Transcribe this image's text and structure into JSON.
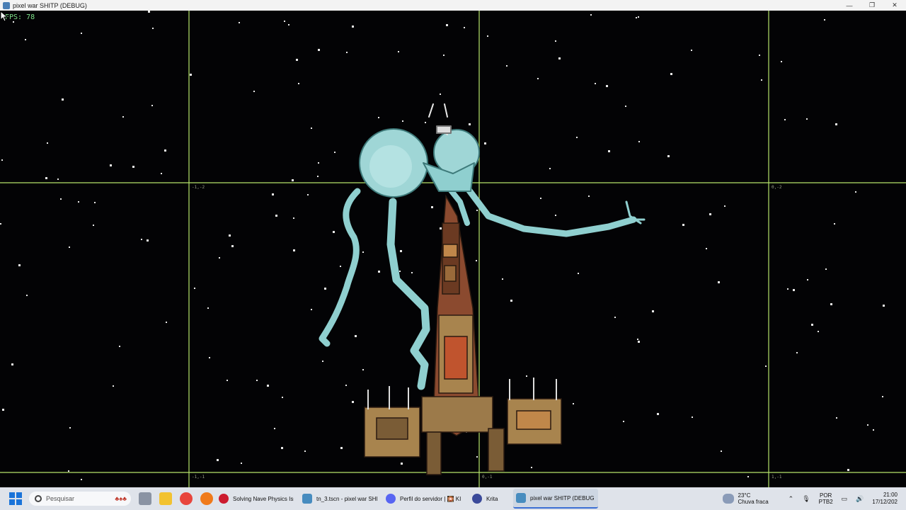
{
  "window": {
    "title": "pixel war SHITP (DEBUG)",
    "minimize": "—",
    "restore": "❐",
    "close": "✕"
  },
  "hud": {
    "fps": "FPS: 78"
  },
  "grid_labels": {
    "tl": "-1,-2",
    "tr": "0,-2",
    "bl": "-1,-1",
    "bm": "0,-1",
    "br": "1,-1"
  },
  "taskbar": {
    "search_placeholder": "Pesquisar",
    "search_deco": "♣♠♣",
    "apps": [
      {
        "label": "Solving Nave Physics Iss",
        "icon": "opera-icon",
        "color": "#cc1b2f"
      },
      {
        "label": "tn_3.tscn - pixel war SHI",
        "icon": "godot-icon",
        "color": "#478cbf"
      },
      {
        "label": "Perfil do servidor | 🎇 KI",
        "icon": "discord-icon",
        "color": "#5865f2"
      },
      {
        "label": "Krita",
        "icon": "krita-icon",
        "color": "#3b4a9a"
      },
      {
        "label": "pixel war SHITP (DEBUG",
        "icon": "godot-icon",
        "color": "#478cbf"
      }
    ],
    "weather": {
      "temp": "23°C",
      "desc": "Chuva fraca"
    },
    "lang": {
      "line1": "POR",
      "line2": "PTB2"
    },
    "clock": {
      "time": "21:00",
      "date": "17/12/202"
    }
  },
  "colors": {
    "creature": "#8fcfcf",
    "creature_outline": "#3e7a7a",
    "grid": "#b6e36a",
    "ship_hull": "#8b4a2f",
    "ship_body": "#a8844e"
  }
}
